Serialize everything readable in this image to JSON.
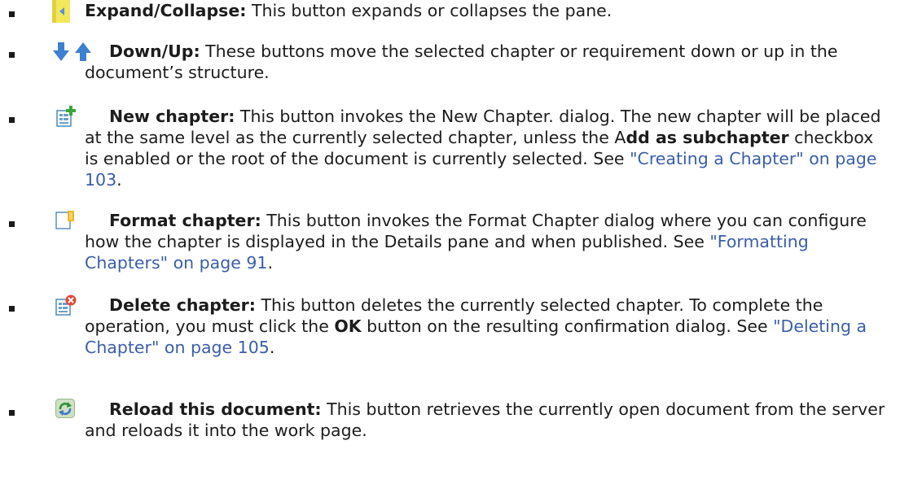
{
  "items": [
    {
      "icon": "expand-collapse-icon",
      "term": "Expand/Collapse:",
      "text": " This button expands or collapses the pane."
    },
    {
      "icon": "down-up-arrows-icon",
      "term": "Down/Up:",
      "text": " These buttons move the selected chapter or requirement down or up in the document’s structure."
    },
    {
      "icon": "new-chapter-icon",
      "term": "New chapter:",
      "text_1": " This button invokes the New Chapter. dialog. The new chapter will be placed at the same level as the currently selected chapter, unless the A",
      "bold_1": "dd as subchapter",
      "text_2": " checkbox is enabled or the root of the document is currently selected. See ",
      "link": "\"Creating a Chapter\" on page 103",
      "end": "."
    },
    {
      "icon": "format-chapter-icon",
      "term": "Format chapter:",
      "text_1": " This button invokes the Format Chapter dialog where you can configure how the chapter is displayed in the Details pane and when published. See ",
      "link": "\"Formatting Chapters\" on page 91",
      "end": "."
    },
    {
      "icon": "delete-chapter-icon",
      "term": "Delete chapter:",
      "text_1": " This button deletes the currently selected chapter. To complete the operation, you must click the ",
      "bold_1": "OK",
      "text_2": " button on the resulting confirmation dialog. See ",
      "link": "\"Deleting a Chapter\" on page 105",
      "end": "."
    },
    {
      "icon": "reload-document-icon",
      "term": "Reload this document:",
      "text": " This button retrieves the currently open document from the server and reloads it into the work page."
    }
  ]
}
